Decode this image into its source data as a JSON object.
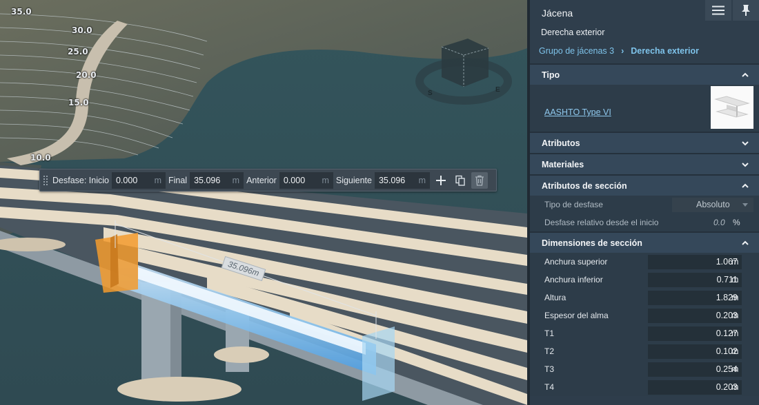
{
  "viewport": {
    "contour_labels": [
      "35.0",
      "30.0",
      "25.0",
      "20.0",
      "15.0",
      "10.0"
    ],
    "compass": [
      "S",
      "E"
    ],
    "dimension_label": "35.096m"
  },
  "offset_toolbar": {
    "offset_label": "Desfase: Inicio",
    "start_value": "0.000",
    "end_label": "Final",
    "end_value": "35.096",
    "prev_label": "Anterior",
    "prev_value": "0.000",
    "next_label": "Siguiente",
    "next_value": "35.096",
    "unit": "m",
    "icons": [
      "plus-icon",
      "copy-icon",
      "trash-icon"
    ]
  },
  "panel": {
    "title": "Jácena",
    "subtitle": "Derecha exterior",
    "breadcrumb": {
      "parent": "Grupo de jácenas 3",
      "separator": "›",
      "current": "Derecha exterior"
    },
    "header_icons": [
      "menu-icon",
      "pin-icon"
    ],
    "sections": {
      "tipo": {
        "label": "Tipo",
        "link": "AASHTO Type VI"
      },
      "atributos": {
        "label": "Atributos"
      },
      "materiales": {
        "label": "Materiales"
      },
      "atributos_seccion": {
        "label": "Atributos de sección",
        "offset_type_label": "Tipo de desfase",
        "offset_type_value": "Absoluto",
        "relative_label": "Desfase relativo desde el inicio",
        "relative_value": "0.0",
        "relative_unit": "%"
      },
      "dimensiones": {
        "label": "Dimensiones de sección",
        "unit": "m",
        "rows": [
          {
            "label": "Anchura superior",
            "value": "1.067"
          },
          {
            "label": "Anchura inferior",
            "value": "0.711"
          },
          {
            "label": "Altura",
            "value": "1.829"
          },
          {
            "label": "Espesor del alma",
            "value": "0.203"
          },
          {
            "label": "T1",
            "value": "0.127"
          },
          {
            "label": "T2",
            "value": "0.102"
          },
          {
            "label": "T3",
            "value": "0.254"
          },
          {
            "label": "T4",
            "value": "0.203"
          }
        ]
      }
    }
  }
}
